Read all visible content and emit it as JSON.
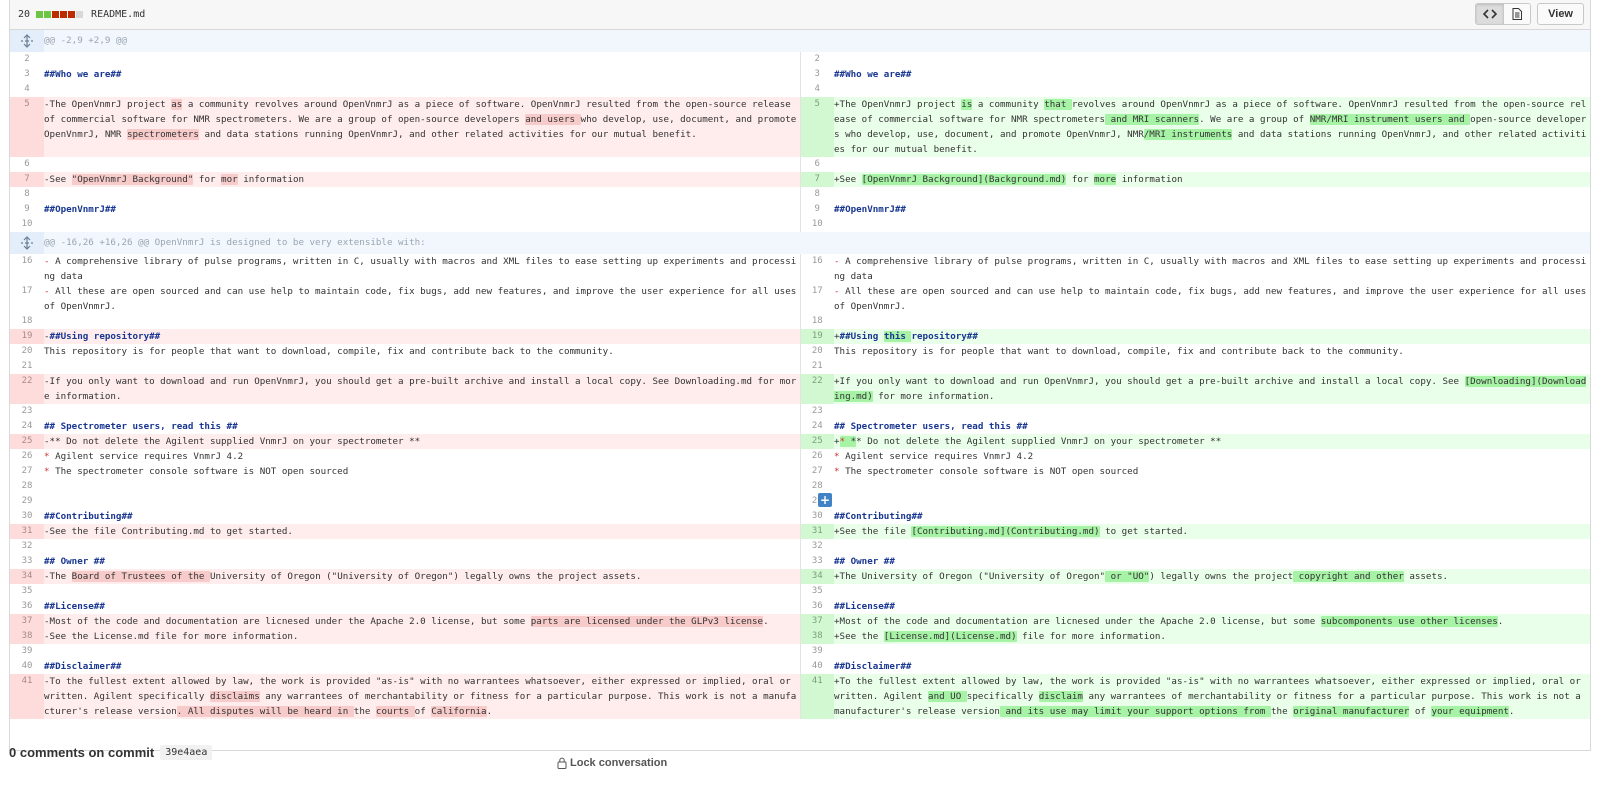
{
  "file": {
    "additions_deletions": "20",
    "diffstat_colors": [
      "#6cc644",
      "#6cc644",
      "#bd2c00",
      "#bd2c00",
      "#bd2c00",
      "#d8d8d8"
    ],
    "name": "README.md",
    "view_label": "View",
    "toggle_icons": [
      "code-icon",
      "file-text-icon"
    ]
  },
  "hunks": {
    "first": "@@ -2,9 +2,9 @@",
    "second": "@@ -16,26 +16,26 @@ OpenVnmrJ is designed to be very extensible with:"
  },
  "commit": {
    "comments_label": "0 comments on commit",
    "sha": "39e4aea",
    "lock_label": "Lock conversation"
  },
  "rows": {
    "r2": {
      "ln": "2",
      "rn": "2"
    },
    "r3": {
      "ln": "3",
      "rn": "3",
      "l": "##Who we are##",
      "r": "##Who we are##"
    },
    "r4": {
      "ln": "4",
      "rn": "4"
    },
    "r5": {
      "ln": "5",
      "rn": "5",
      "l1": "-The OpenVnmrJ project ",
      "l2": "as",
      "l3": " a community revolves around OpenVnmrJ as a piece of software. OpenVnmrJ resulted from the open-source release of commercial software for NMR spectrometers. We are a group of open-source developers ",
      "l4": "and users ",
      "l5": "who develop, use, document, and promote OpenVnmrJ, NMR ",
      "l6": "spectrometers",
      "l7": " and data stations running OpenVnmrJ, and other related activities for our mutual benefit.",
      "r1": "+The OpenVnmrJ project ",
      "r2": "is",
      "r3": " a community ",
      "r4": "that ",
      "r5": "revolves around OpenVnmrJ as a piece of software. OpenVnmrJ resulted from the open-source release of commercial software for NMR spectrometers",
      "r6": " and MRI scanners",
      "r7": ". We are a group of ",
      "r8": "NMR/MRI instrument users and ",
      "r9": "open-source developers who develop, use, document, and promote OpenVnmrJ, NMR",
      "r10": "/MRI instruments",
      "r11": " and data stations running OpenVnmrJ, and other related activities for our mutual benefit."
    },
    "r6": {
      "ln": "6",
      "rn": "6"
    },
    "r7": {
      "ln": "7",
      "rn": "7",
      "l1": "-See ",
      "l2": "\"OpenVnmrJ Background\"",
      "l3": " for ",
      "l4": "mor",
      "l5": " information",
      "r1": "+See ",
      "r2": "[OpenVnmrJ Background](Background.md)",
      "r3": " for ",
      "r4": "more",
      "r5": " information"
    },
    "r8": {
      "ln": "8",
      "rn": "8"
    },
    "r9": {
      "ln": "9",
      "rn": "9",
      "l": "##OpenVnmrJ##",
      "r": "##OpenVnmrJ##"
    },
    "r10": {
      "ln": "10",
      "rn": "10"
    },
    "r16": {
      "ln": "16",
      "rn": "16",
      "l": " A comprehensive library of pulse programs, written in C, usually with macros and XML files to ease setting up experiments and processing data",
      "r": " A comprehensive library of pulse programs, written in C, usually with macros and XML files to ease setting up experiments and processing data"
    },
    "r17": {
      "ln": "17",
      "rn": "17",
      "l": " All these are open sourced and can use help to maintain code, fix bugs, add new features, and improve the user experience for all uses of OpenVnmrJ.",
      "r": " All these are open sourced and can use help to maintain code, fix bugs, add new features, and improve the user experience for all uses of OpenVnmrJ."
    },
    "r18": {
      "ln": "18",
      "rn": "18"
    },
    "r19": {
      "ln": "19",
      "rn": "19",
      "l1": "-",
      "l2": "##Using repository##",
      "r1": "+",
      "r2": "##Using ",
      "r3": "this ",
      "r4": "repository##"
    },
    "r20": {
      "ln": "20",
      "rn": "20",
      "l": "This repository is for people that want to download, compile, fix and contribute back to the community.",
      "r": "This repository is for people that want to download, compile, fix and contribute back to the community."
    },
    "r21": {
      "ln": "21",
      "rn": "21"
    },
    "r22": {
      "ln": "22",
      "rn": "22",
      "l": "-If you only want to download and run OpenVnmrJ, you should get a pre-built archive and install a local copy. See Downloading.md for more information.",
      "r1": "+If you only want to download and run OpenVnmrJ, you should get a pre-built archive and install a local copy. See ",
      "r2": "[Downloading](Downloading.md)",
      "r3": " for more information."
    },
    "r23": {
      "ln": "23",
      "rn": "23"
    },
    "r24": {
      "ln": "24",
      "rn": "24",
      "l": "## Spectrometer users, read this ##",
      "r": "## Spectrometer users, read this ##"
    },
    "r25": {
      "ln": "25",
      "rn": "25",
      "l": "-** Do not delete the Agilent supplied VnmrJ on your spectrometer **",
      "r1": "+",
      "r2": "* ",
      "r3": "*",
      "r4": "* Do not delete the Agilent supplied VnmrJ on your spectrometer **"
    },
    "r26": {
      "ln": "26",
      "rn": "26",
      "l": " Agilent service requires VnmrJ 4.2",
      "r": " Agilent service requires VnmrJ 4.2"
    },
    "r27": {
      "ln": "27",
      "rn": "27",
      "l": " The spectrometer console software is NOT open sourced",
      "r": " The spectrometer console software is NOT open sourced"
    },
    "r28": {
      "ln": "28",
      "rn": "28"
    },
    "r29": {
      "ln": "29",
      "rn": "29"
    },
    "r30": {
      "ln": "30",
      "rn": "30",
      "l": "##Contributing##",
      "r": "##Contributing##"
    },
    "r31": {
      "ln": "31",
      "rn": "31",
      "l": "-See the file Contributing.md to get started.",
      "r1": "+See the file ",
      "r2": "[Contributing.md](Contributing.md)",
      "r3": " to get started."
    },
    "r32": {
      "ln": "32",
      "rn": "32"
    },
    "r33": {
      "ln": "33",
      "rn": "33",
      "l": "## Owner ##",
      "r": "## Owner ##"
    },
    "r34": {
      "ln": "34",
      "rn": "34",
      "l1": "-The ",
      "l2": "Board of Trustees of the ",
      "l3": "University of Oregon (\"University of Oregon\") legally owns the project assets.",
      "r1": "+The University of Oregon (\"University of Oregon\"",
      "r2": " or \"UO\"",
      "r3": ") legally owns the project",
      "r4": " copyright and other",
      "r5": " assets."
    },
    "r35": {
      "ln": "35",
      "rn": "35"
    },
    "r36": {
      "ln": "36",
      "rn": "36",
      "l": "##License##",
      "r": "##License##"
    },
    "r37": {
      "ln": "37",
      "rn": "37",
      "l1": "-Most of the code and documentation are licnesed under the Apache 2.0 license, but some ",
      "l2": "parts are licensed under the GLPv3 license",
      "l3": ".",
      "r1": "+Most of the code and documentation are licnesed under the Apache 2.0 license, but some ",
      "r2": "subcomponents use other licenses",
      "r3": "."
    },
    "r38": {
      "ln": "38",
      "rn": "38",
      "l": "-See the License.md file for more information.",
      "r1": "+See the ",
      "r2": "[License.md](License.md)",
      "r3": " file for more information."
    },
    "r39": {
      "ln": "39",
      "rn": "39"
    },
    "r40": {
      "ln": "40",
      "rn": "40",
      "l": "##Disclaimer##",
      "r": "##Disclaimer##"
    },
    "r41": {
      "ln": "41",
      "rn": "41",
      "l1": "-To the fullest extent allowed by law, the work is provided \"as-is\" with no warrantees whatsoever, either expressed or implied, oral or written. Agilent specifically ",
      "l2": "disclaims",
      "l3": " any warrantees of merchantability or fitness for a particular purpose. This work is not a manufacturer's release version",
      "l4": ". All disputes will be heard in ",
      "l5": "the ",
      "l6": "courts ",
      "l7": "of ",
      "l8": "California",
      "l9": ".",
      "r1": "+To the fullest extent allowed by law, the work is provided \"as-is\" with no warrantees whatsoever, either expressed or implied, oral or written. Agilent ",
      "r2": "and UO ",
      "r3": "specifically ",
      "r4": "disclaim",
      "r5": " any warrantees of merchantability or fitness for a particular purpose. This work is not a manufacturer's release version",
      "r6": " and its use may limit your support options from ",
      "r7": "the ",
      "r8": "original manufacturer",
      "r9": " of ",
      "r10": "your equipment",
      "r11": "."
    }
  }
}
